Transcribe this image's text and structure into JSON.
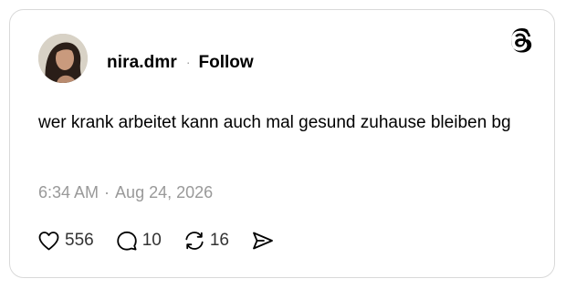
{
  "post": {
    "author": {
      "username": "nira.dmr",
      "follow_label": "Follow",
      "separator": "·"
    },
    "text": "wer krank arbeitet kann auch mal gesund zuhause bleiben bg",
    "timestamp": {
      "time": "6:34 AM",
      "separator": "·",
      "date": "Aug 24, 2026"
    },
    "actions": {
      "likes": "556",
      "replies": "10",
      "reposts": "16"
    },
    "icons": {
      "brand": "threads-logo-icon",
      "like": "heart-icon",
      "reply": "speech-bubble-icon",
      "repost": "repost-arrows-icon",
      "share": "paper-plane-icon"
    }
  },
  "colors": {
    "text": "#000000",
    "muted": "#999999",
    "count": "#333333",
    "border": "#d9d9d9"
  }
}
